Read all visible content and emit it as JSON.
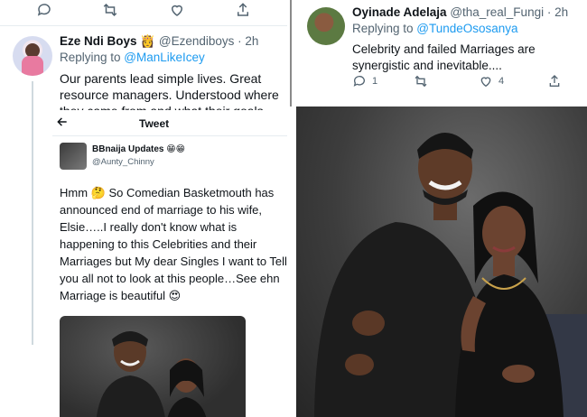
{
  "left_tweet": {
    "name": "Eze Ndi Boys",
    "badge": "👸",
    "handle": "@Ezendiboys",
    "time": "2h",
    "replying_prefix": "Replying to ",
    "replying_to": "@ManLikeIcey",
    "text": "Our parents lead simple lives. Great resource managers. Understood where they came from and what their goals"
  },
  "embed": {
    "back_icon": "arrow-left-icon",
    "header_title": "Tweet",
    "name": "BBnaija Updates 😁😁",
    "handle": "@Aunty_Chinny",
    "text": "Hmm 🤔 So Comedian Basketmouth has announced end of marriage to his wife, Elsie…..I really don't know what is happening to this Celebrities and their Marriages but My dear Singles I want to Tell you all not to look at this people…See ehn Marriage is beautiful 😍"
  },
  "right_tweet": {
    "name": "Oyinade Adelaja",
    "handle": "@tha_real_Fungi",
    "time": "2h",
    "replying_prefix": "Replying to ",
    "replying_to": "@TundeOsosanya",
    "text": "Celebrity and  failed Marriages are synergistic and inevitable....",
    "reply_count": "1",
    "retweet_count": "",
    "like_count": "4"
  },
  "colors": {
    "link": "#1d9bf0",
    "muted": "#536471",
    "text": "#0f1419"
  }
}
